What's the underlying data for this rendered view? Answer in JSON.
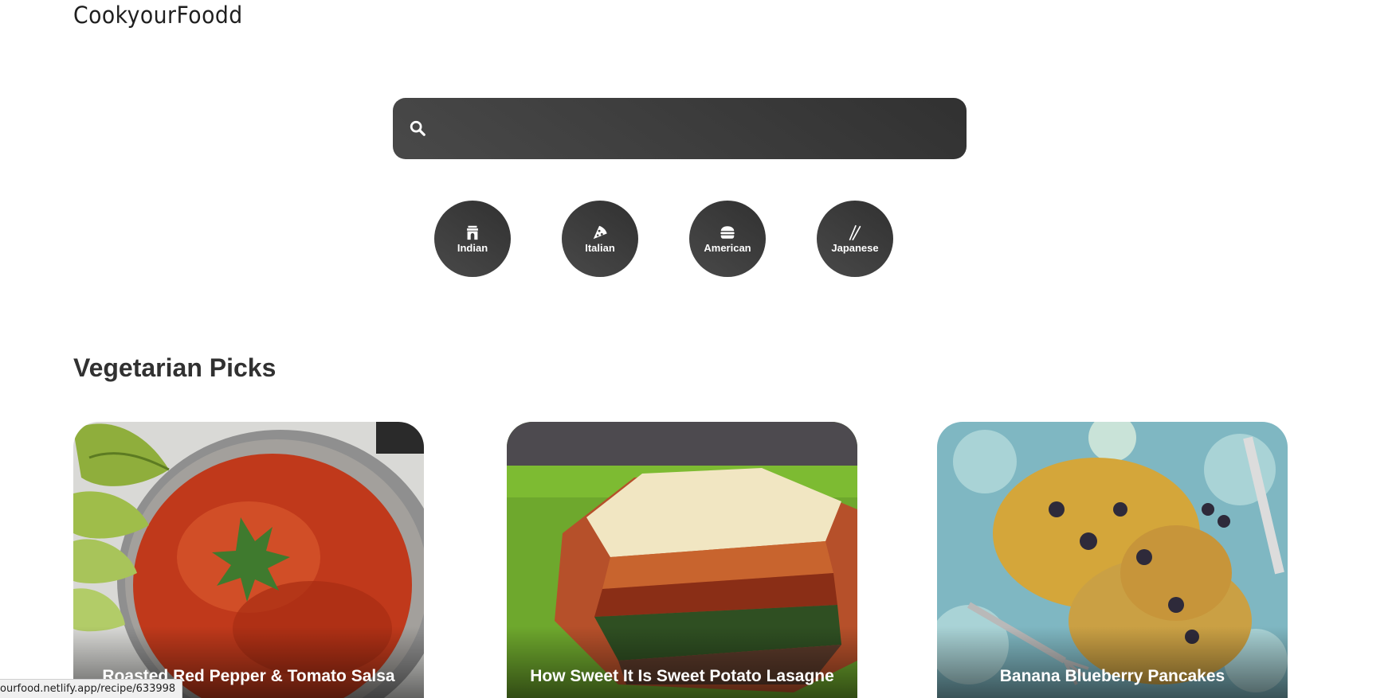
{
  "app": {
    "logo_text": "CookyourFoodd"
  },
  "search": {
    "placeholder": "",
    "value": "",
    "icon": "search-icon"
  },
  "cuisines": [
    {
      "label": "Indian",
      "icon": "india-gate-icon"
    },
    {
      "label": "Italian",
      "icon": "pizza-icon"
    },
    {
      "label": "American",
      "icon": "burger-icon"
    },
    {
      "label": "Japanese",
      "icon": "chopsticks-icon"
    }
  ],
  "section": {
    "title": "Vegetarian Picks"
  },
  "recipes": [
    {
      "title": "Roasted Red Pepper & Tomato Salsa"
    },
    {
      "title": "How Sweet It Is Sweet Potato Lasagne"
    },
    {
      "title": "Banana Blueberry Pancakes"
    }
  ],
  "status_bar": {
    "url": "ourfood.netlify.app/recipe/633998"
  },
  "colors": {
    "dark": "#313131",
    "dark_light": "#494949"
  }
}
